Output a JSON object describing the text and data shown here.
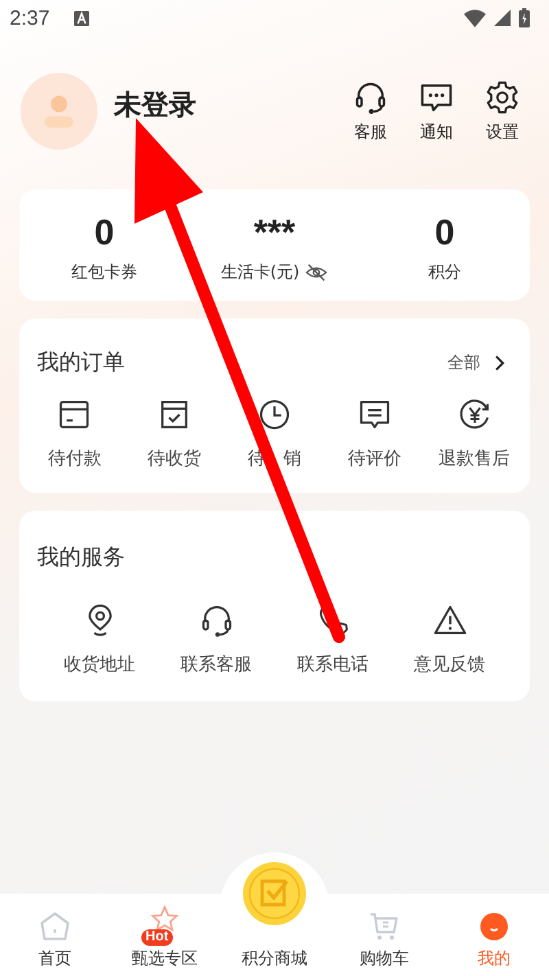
{
  "status_bar": {
    "time": "2:37"
  },
  "profile": {
    "name": "未登录"
  },
  "header_actions": [
    {
      "kind": "headset",
      "label": "客服"
    },
    {
      "kind": "message",
      "label": "通知"
    },
    {
      "kind": "gear",
      "label": "设置"
    }
  ],
  "stats": [
    {
      "value": "0",
      "label": "红包卡券",
      "hidden_toggle": false
    },
    {
      "value": "***",
      "label": "生活卡(元)",
      "hidden_toggle": true
    },
    {
      "value": "0",
      "label": "积分",
      "hidden_toggle": false
    }
  ],
  "orders": {
    "title": "我的订单",
    "all_link": "全部",
    "items": [
      {
        "kind": "card",
        "label": "待付款"
      },
      {
        "kind": "box",
        "label": "待收货"
      },
      {
        "kind": "clock",
        "label_parts": [
          "待",
          "销"
        ]
      },
      {
        "kind": "comment",
        "label": "待评价"
      },
      {
        "kind": "refund",
        "label": "退款售后"
      }
    ]
  },
  "services": {
    "title": "我的服务",
    "items": [
      {
        "kind": "location",
        "label": "收货地址"
      },
      {
        "kind": "headset",
        "label": "联系客服"
      },
      {
        "kind": "phone",
        "label": "联系电话"
      },
      {
        "kind": "warning",
        "label": "意见反馈"
      }
    ]
  },
  "bottom_nav": [
    {
      "kind": "home",
      "label": "首页",
      "selected": false
    },
    {
      "kind": "hot",
      "label": "甄选专区",
      "badge": "Hot",
      "selected": false
    },
    {
      "kind": "coin",
      "label": "积分商城",
      "selected": false
    },
    {
      "kind": "cart",
      "label": "购物车",
      "selected": false
    },
    {
      "kind": "me",
      "label": "我的",
      "selected": true
    }
  ]
}
